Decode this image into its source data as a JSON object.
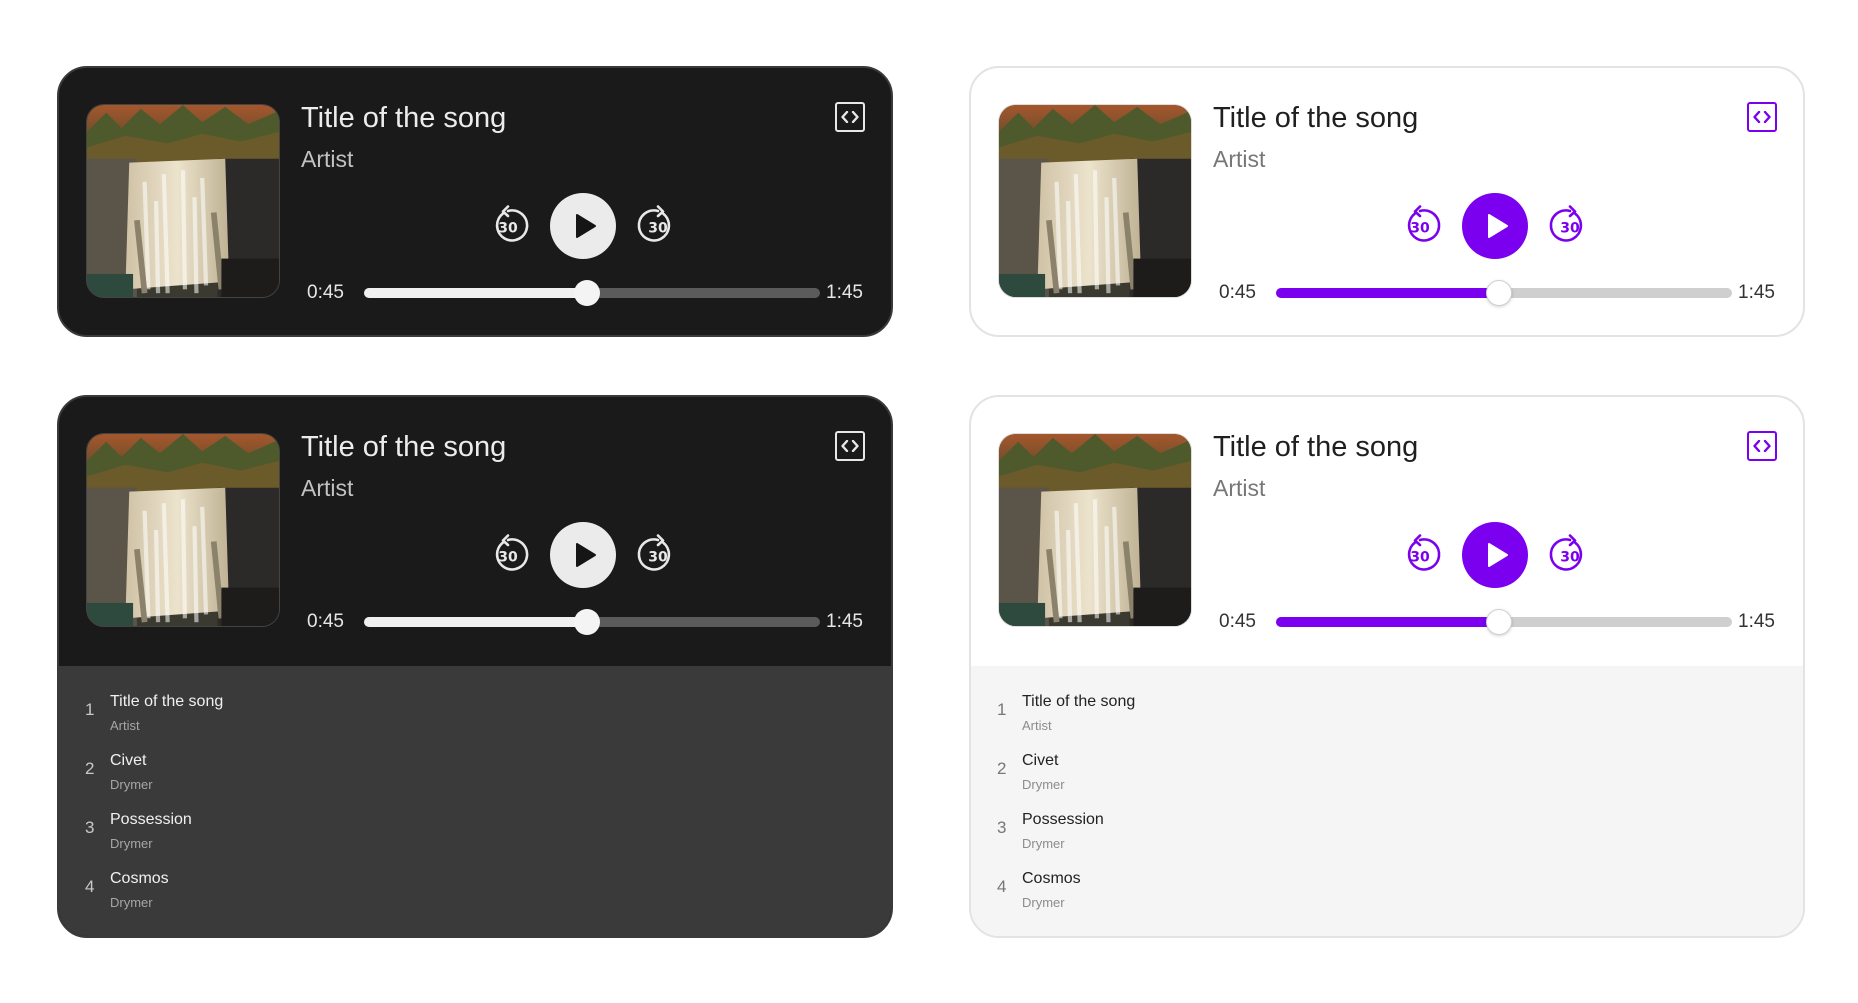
{
  "theme_colors": {
    "dark_bg": "#1a1a1a",
    "dark_playlist_bg": "#3a3a3a",
    "light_bg": "#ffffff",
    "light_playlist_bg": "#f5f5f5",
    "accent": "#7a00ef"
  },
  "icons": {
    "embed": "embed-code-icon",
    "skip_back": "rewind-30-icon",
    "play": "play-icon",
    "skip_forward": "forward-30-icon"
  },
  "players": [
    {
      "theme": "dark",
      "song_title": "Title of the song",
      "artist": "Artist",
      "current_time": "0:45",
      "total_time": "1:45",
      "progress": 0.49,
      "skip_back_label": "30",
      "skip_forward_label": "30"
    },
    {
      "theme": "light",
      "song_title": "Title of the song",
      "artist": "Artist",
      "current_time": "0:45",
      "total_time": "1:45",
      "progress": 0.49,
      "skip_back_label": "30",
      "skip_forward_label": "30"
    },
    {
      "theme": "dark",
      "song_title": "Title of the song",
      "artist": "Artist",
      "current_time": "0:45",
      "total_time": "1:45",
      "progress": 0.49,
      "skip_back_label": "30",
      "skip_forward_label": "30",
      "playlist": [
        {
          "num": "1",
          "title": "Title of the song",
          "artist": "Artist"
        },
        {
          "num": "2",
          "title": "Civet",
          "artist": "Drymer"
        },
        {
          "num": "3",
          "title": "Possession",
          "artist": "Drymer"
        },
        {
          "num": "4",
          "title": "Cosmos",
          "artist": "Drymer"
        }
      ]
    },
    {
      "theme": "light",
      "song_title": "Title of the song",
      "artist": "Artist",
      "current_time": "0:45",
      "total_time": "1:45",
      "progress": 0.49,
      "skip_back_label": "30",
      "skip_forward_label": "30",
      "playlist": [
        {
          "num": "1",
          "title": "Title of the song",
          "artist": "Artist"
        },
        {
          "num": "2",
          "title": "Civet",
          "artist": "Drymer"
        },
        {
          "num": "3",
          "title": "Possession",
          "artist": "Drymer"
        },
        {
          "num": "4",
          "title": "Cosmos",
          "artist": "Drymer"
        }
      ]
    }
  ]
}
